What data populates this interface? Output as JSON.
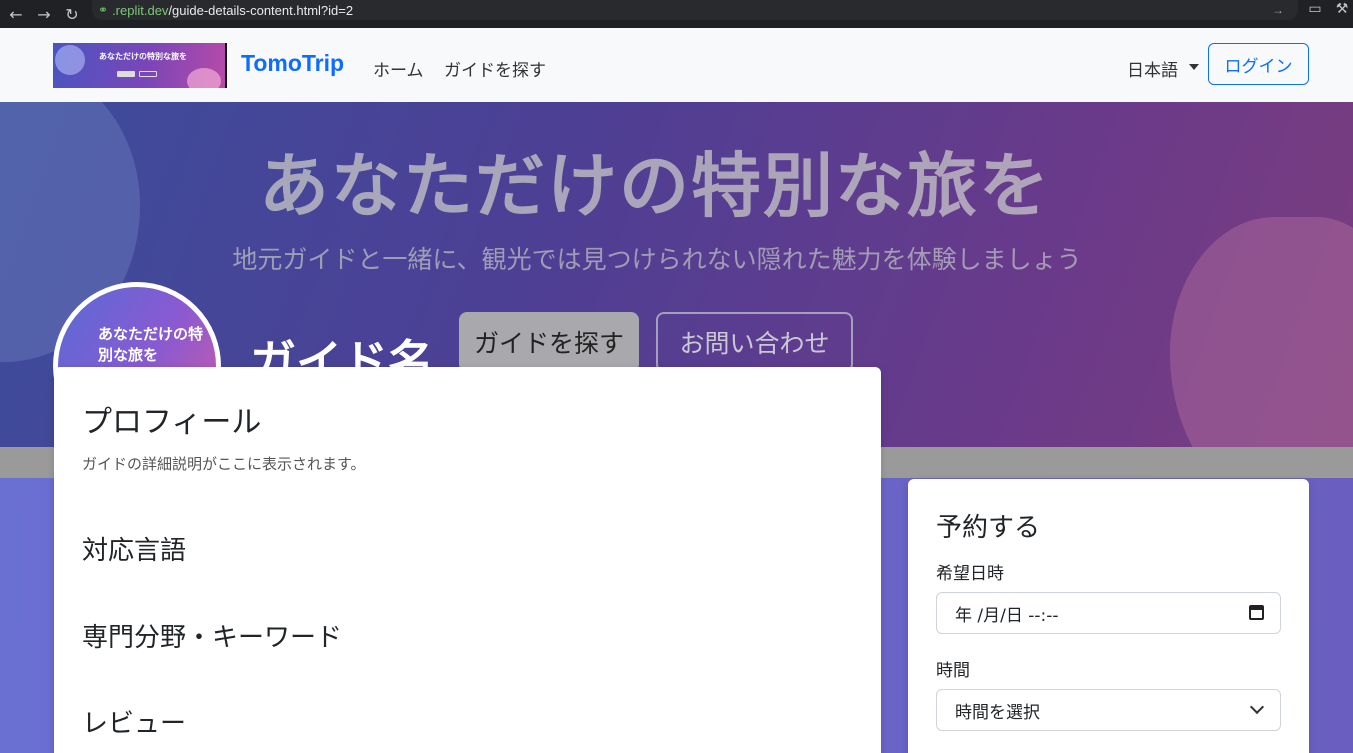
{
  "browser": {
    "url_host": ".replit.dev",
    "url_path": "/guide-details-content.html?id=2"
  },
  "navbar": {
    "brand": "TomoTrip",
    "links": [
      "ホーム",
      "ガイドを探す"
    ],
    "language": "日本語",
    "login": "ログイン",
    "logo_thumb_title": "あなただけの特別な旅を"
  },
  "hero": {
    "title": "あなただけの特別な旅を",
    "subtitle": "地元ガイドと一緒に、観光では見つけられない隠れた魅力を体験しましょう",
    "avatar_text": "あなただけの特別な旅を",
    "guide_name": "ガイド名",
    "find_button": "ガイドを探す",
    "contact_button": "お問い合わせ"
  },
  "profile": {
    "heading": "プロフィール",
    "description": "ガイドの詳細説明がここに表示されます。",
    "languages_heading": "対応言語",
    "specialty_heading": "専門分野・キーワード",
    "reviews_heading": "レビュー"
  },
  "booking": {
    "title": "予約する",
    "date_label": "希望日時",
    "date_value": "年 /月/日 --:--",
    "time_label": "時間",
    "time_value": "時間を選択"
  }
}
